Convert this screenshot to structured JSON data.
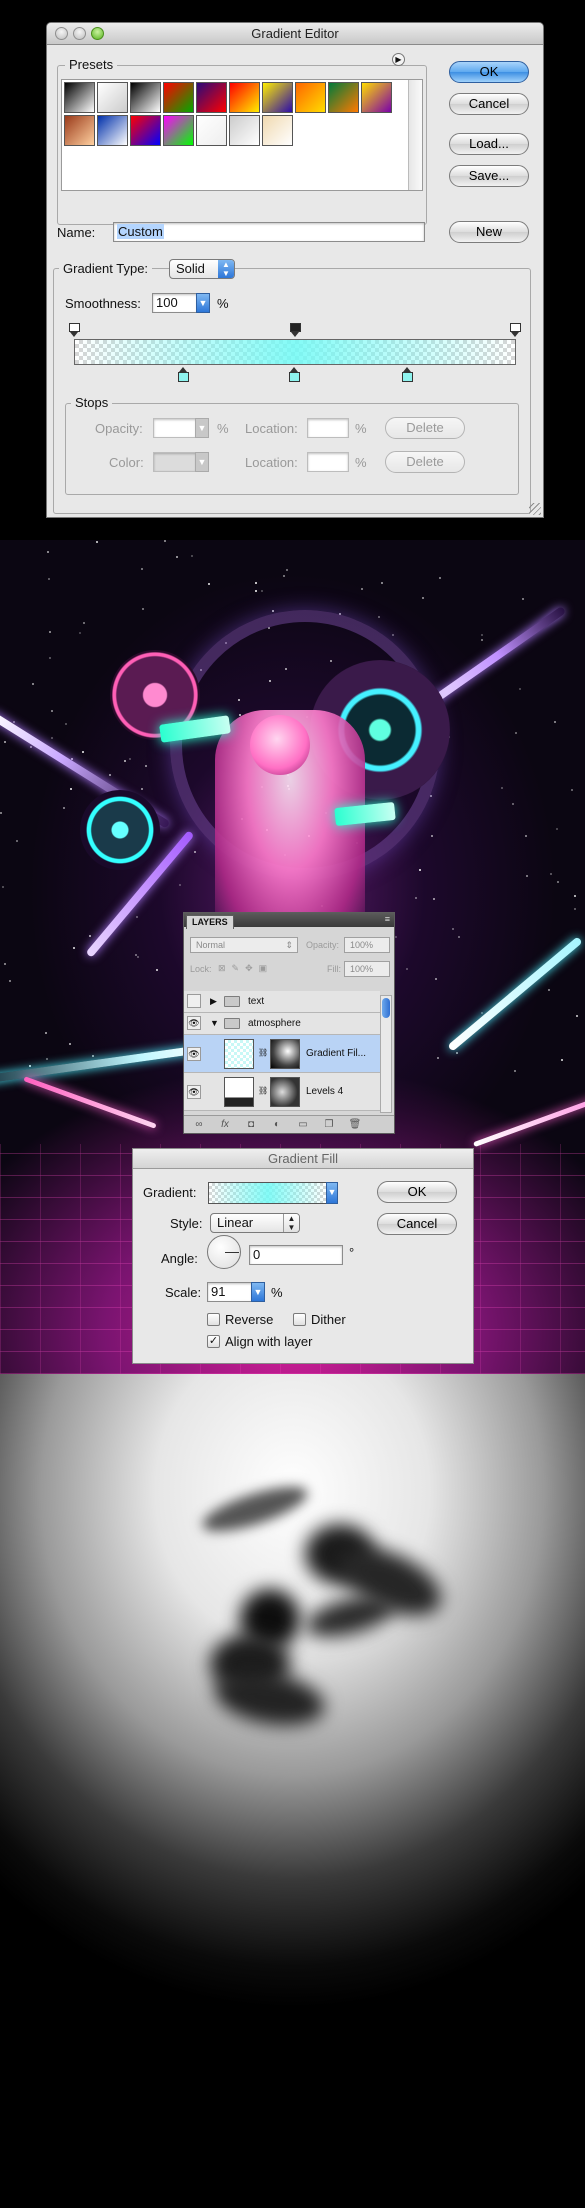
{
  "gradient_editor": {
    "title": "Gradient Editor",
    "presets_label": "Presets",
    "ok": "OK",
    "cancel": "Cancel",
    "load": "Load...",
    "save": "Save...",
    "name_label": "Name:",
    "name_value": "Custom",
    "new": "New",
    "gradient_type_label": "Gradient Type:",
    "gradient_type_value": "Solid",
    "smoothness_label": "Smoothness:",
    "smoothness_value": "100",
    "percent": "%",
    "stops_label": "Stops",
    "opacity_label": "Opacity:",
    "color_label": "Color:",
    "location_label": "Location:",
    "delete": "Delete",
    "preset_colors": [
      [
        "#000000",
        "#ffffff"
      ],
      [
        "#ffffff",
        "#cccccc"
      ],
      [
        "#000000",
        "#ffffff"
      ],
      [
        "#ff0000",
        "#00aa00"
      ],
      [
        "#2a0a7a",
        "#ff0000"
      ],
      [
        "#ff0000",
        "#ffee00"
      ],
      [
        "#ffee00",
        "#2a0aaa"
      ],
      [
        "#ff6600",
        "#ffdd00"
      ],
      [
        "#007a3a",
        "#ff7a00"
      ],
      [
        "#ffdd00",
        "#7a00aa"
      ],
      [
        "#9a3a1a",
        "#ffd0a0"
      ],
      [
        "#0030aa",
        "#ffffff"
      ],
      [
        "#ff0000",
        "#0000ff"
      ],
      [
        "#ff00ff",
        "#00ff00"
      ],
      [
        "#ffffff",
        "#eeeeee"
      ],
      [
        "#cccccc",
        "#ffffff"
      ],
      [
        "#f0d9b0",
        "#ffffff"
      ]
    ]
  },
  "layers_panel": {
    "tab": "LAYERS",
    "blend_mode": "Normal",
    "opacity_label": "Opacity:",
    "opacity_value": "100%",
    "lock_label": "Lock:",
    "fill_label": "Fill:",
    "fill_value": "100%",
    "layers": [
      {
        "name": "text",
        "type": "group",
        "visible": false
      },
      {
        "name": "atmosphere",
        "type": "group",
        "visible": true
      },
      {
        "name": "Gradient Fil...",
        "type": "layer",
        "visible": true,
        "selected": true
      },
      {
        "name": "Levels 4",
        "type": "layer",
        "visible": true
      }
    ]
  },
  "gradient_fill": {
    "title": "Gradient Fill",
    "gradient_label": "Gradient:",
    "ok": "OK",
    "cancel": "Cancel",
    "style_label": "Style:",
    "style_value": "Linear",
    "angle_label": "Angle:",
    "angle_value": "0",
    "degree": "°",
    "scale_label": "Scale:",
    "scale_value": "91",
    "percent": "%",
    "reverse": "Reverse",
    "dither": "Dither",
    "align": "Align with layer",
    "reverse_checked": false,
    "dither_checked": false,
    "align_checked": true
  }
}
